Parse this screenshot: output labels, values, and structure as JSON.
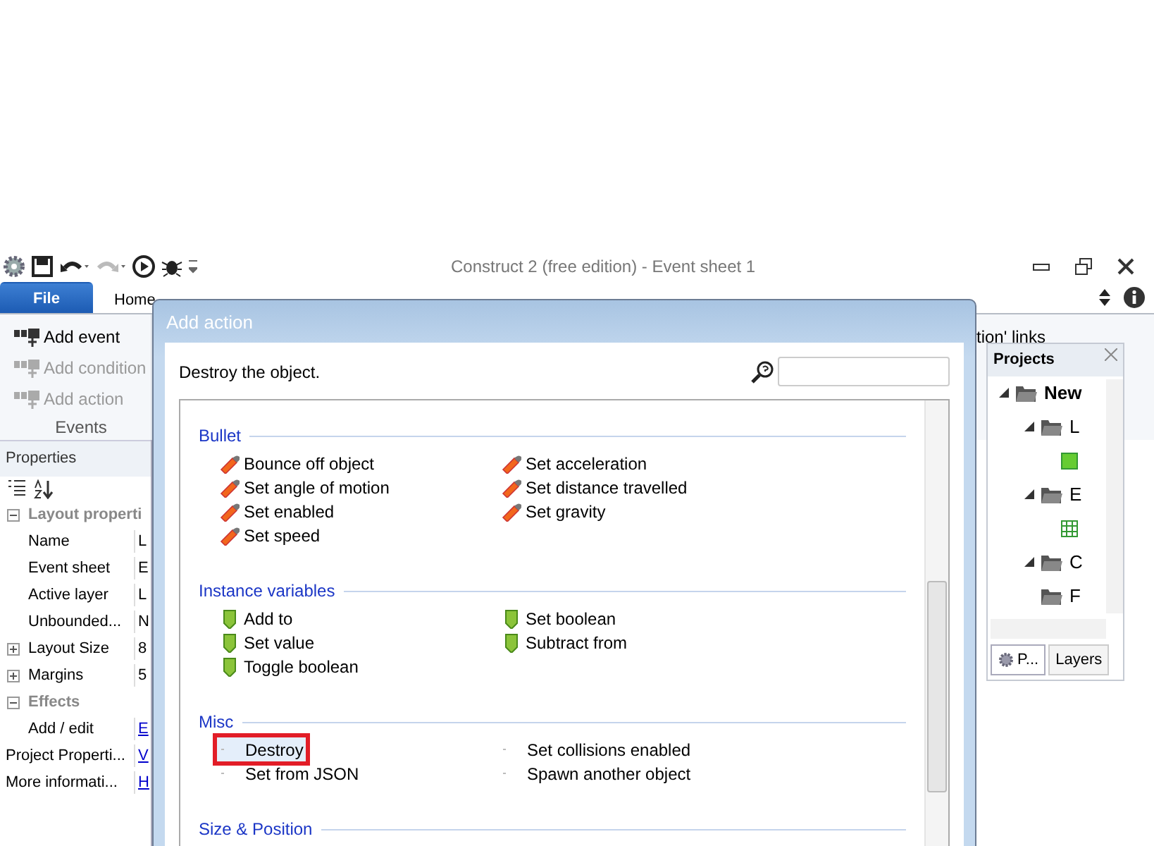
{
  "window": {
    "title": "Construct 2  (free edition) - Event sheet 1"
  },
  "ribbon": {
    "tabs": [
      {
        "label": "File",
        "kind": "file",
        "selected": false
      },
      {
        "label": "Home",
        "kind": "tab",
        "selected": false
      }
    ],
    "group": {
      "label": "Events",
      "buttons": [
        {
          "label": "Add event",
          "disabled": false
        },
        {
          "label": "Add condition",
          "disabled": true
        },
        {
          "label": "Add action",
          "disabled": true
        }
      ]
    }
  },
  "background_text": "tion' links",
  "properties": {
    "title": "Properties",
    "rows": [
      {
        "kind": "section",
        "name": "Layout properti",
        "expanded": true
      },
      {
        "kind": "prop",
        "name": "Name",
        "value": "L"
      },
      {
        "kind": "prop",
        "name": "Event sheet",
        "value": "E"
      },
      {
        "kind": "prop",
        "name": "Active layer",
        "value": "L"
      },
      {
        "kind": "prop",
        "name": "Unbounded...",
        "value": "N"
      },
      {
        "kind": "group",
        "name": "Layout Size",
        "value": "8",
        "expanded": false
      },
      {
        "kind": "group",
        "name": "Margins",
        "value": "5",
        "expanded": false
      },
      {
        "kind": "section",
        "name": "Effects",
        "expanded": true
      },
      {
        "kind": "prop",
        "name": "Add / edit",
        "value": "E",
        "link": true
      },
      {
        "kind": "root",
        "name": "Project Properti...",
        "value": "V",
        "link": true
      },
      {
        "kind": "root",
        "name": "More informati...",
        "value": "H",
        "link": true
      }
    ]
  },
  "projects": {
    "title": "Projects",
    "tree": [
      {
        "kind": "folder",
        "label": "New",
        "expanded": true,
        "children": [
          {
            "kind": "folder",
            "label": "L",
            "expanded": true,
            "children": [
              {
                "kind": "layout"
              }
            ]
          },
          {
            "kind": "folder",
            "label": "E",
            "expanded": true,
            "children": [
              {
                "kind": "sheet"
              }
            ]
          },
          {
            "kind": "folder",
            "label": "C",
            "expanded": true
          },
          {
            "kind": "folder",
            "label": "F",
            "expanded": false
          }
        ]
      }
    ],
    "tabs": [
      {
        "label": "P...",
        "selected": true
      },
      {
        "label": "Layers",
        "selected": false
      }
    ]
  },
  "dialog": {
    "title": "Add action",
    "description": "Destroy the object.",
    "groups": [
      {
        "title": "Bullet",
        "kind": "bullet",
        "items": [
          {
            "label": "Bounce off object",
            "selected": false
          },
          {
            "label": "Set acceleration",
            "selected": false
          },
          {
            "label": "Set angle of motion",
            "selected": false
          },
          {
            "label": "Set distance travelled",
            "selected": false
          },
          {
            "label": "Set enabled",
            "selected": false
          },
          {
            "label": "Set gravity",
            "selected": false
          },
          {
            "label": "Set speed",
            "selected": false
          }
        ]
      },
      {
        "title": "Instance variables",
        "kind": "variable",
        "items": [
          {
            "label": "Add to",
            "selected": false
          },
          {
            "label": "Set boolean",
            "selected": false
          },
          {
            "label": "Set value",
            "selected": false
          },
          {
            "label": "Subtract from",
            "selected": false
          },
          {
            "label": "Toggle boolean",
            "selected": false
          }
        ]
      },
      {
        "title": "Misc",
        "kind": "misc",
        "items": [
          {
            "label": "Destroy",
            "selected": true
          },
          {
            "label": "Set collisions enabled",
            "selected": false
          },
          {
            "label": "Set from JSON",
            "selected": false
          },
          {
            "label": "Spawn another object",
            "selected": false
          }
        ]
      },
      {
        "title": "Size & Position"
      }
    ]
  }
}
